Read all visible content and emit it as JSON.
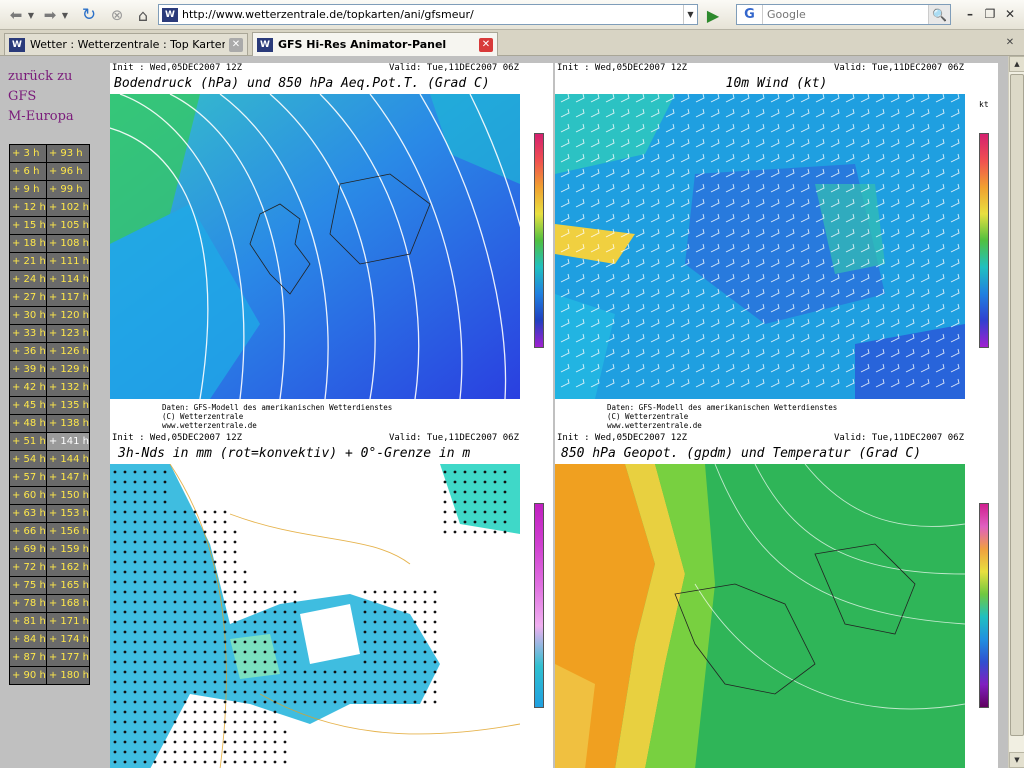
{
  "browser": {
    "url": "http://www.wetterzentrale.de/topkarten/ani/gfsmeur/",
    "search_placeholder": "Google",
    "tabs": [
      {
        "label": "Wetter : Wetterzentrale : Top Karten ..."
      },
      {
        "label": "GFS Hi-Res Animator-Panel"
      }
    ]
  },
  "sidebar": {
    "back_link": [
      "zurück zu",
      "GFS",
      "M-Europa"
    ],
    "selected": "+ 141 h",
    "time_steps": [
      [
        "+ 3 h",
        "+ 93 h"
      ],
      [
        "+ 6 h",
        "+ 96 h"
      ],
      [
        "+ 9 h",
        "+ 99 h"
      ],
      [
        "+ 12 h",
        "+ 102 h"
      ],
      [
        "+ 15 h",
        "+ 105 h"
      ],
      [
        "+ 18 h",
        "+ 108 h"
      ],
      [
        "+ 21 h",
        "+ 111 h"
      ],
      [
        "+ 24 h",
        "+ 114 h"
      ],
      [
        "+ 27 h",
        "+ 117 h"
      ],
      [
        "+ 30 h",
        "+ 120 h"
      ],
      [
        "+ 33 h",
        "+ 123 h"
      ],
      [
        "+ 36 h",
        "+ 126 h"
      ],
      [
        "+ 39 h",
        "+ 129 h"
      ],
      [
        "+ 42 h",
        "+ 132 h"
      ],
      [
        "+ 45 h",
        "+ 135 h"
      ],
      [
        "+ 48 h",
        "+ 138 h"
      ],
      [
        "+ 51 h",
        "+ 141 h"
      ],
      [
        "+ 54 h",
        "+ 144 h"
      ],
      [
        "+ 57 h",
        "+ 147 h"
      ],
      [
        "+ 60 h",
        "+ 150 h"
      ],
      [
        "+ 63 h",
        "+ 153 h"
      ],
      [
        "+ 66 h",
        "+ 156 h"
      ],
      [
        "+ 69 h",
        "+ 159 h"
      ],
      [
        "+ 72 h",
        "+ 162 h"
      ],
      [
        "+ 75 h",
        "+ 165 h"
      ],
      [
        "+ 78 h",
        "+ 168 h"
      ],
      [
        "+ 81 h",
        "+ 171 h"
      ],
      [
        "+ 84 h",
        "+ 174 h"
      ],
      [
        "+ 87 h",
        "+ 177 h"
      ],
      [
        "+ 90 h",
        "+ 180 h"
      ]
    ]
  },
  "panels": {
    "pressure": {
      "init": "Init : Wed,05DEC2007 12Z",
      "valid": "Valid: Tue,11DEC2007 06Z",
      "title": "Bodendruck (hPa) und 850 hPa Aeq.Pot.T. (Grad C)",
      "footer": [
        "Daten: GFS-Modell des amerikanischen Wetterdienstes",
        "(C) Wetterzentrale",
        "www.wetterzentrale.de"
      ]
    },
    "wind": {
      "init": "Init : Wed,05DEC2007 12Z",
      "valid": "Valid: Tue,11DEC2007 06Z",
      "title": "10m Wind (kt)",
      "unit": "kt",
      "footer": [
        "Daten: GFS-Modell des amerikanischen Wetterdienstes",
        "(C) Wetterzentrale",
        "www.wetterzentrale.de"
      ]
    },
    "precip": {
      "init": "Init : Wed,05DEC2007 12Z",
      "valid": "Valid: Tue,11DEC2007 06Z",
      "title": "3h-Nds in mm (rot=konvektiv) + 0°-Grenze in m"
    },
    "geopot": {
      "init": "Init : Wed,05DEC2007 12Z",
      "valid": "Valid: Tue,11DEC2007 06Z",
      "title": "850 hPa Geopot. (gpdm) und Temperatur (Grad C)"
    }
  },
  "colors": {
    "link": "#7a1a7a",
    "cell_bg": "#6a6a6a",
    "cell_text": "#ffe84a",
    "selected_bg": "#9a9a9a"
  }
}
